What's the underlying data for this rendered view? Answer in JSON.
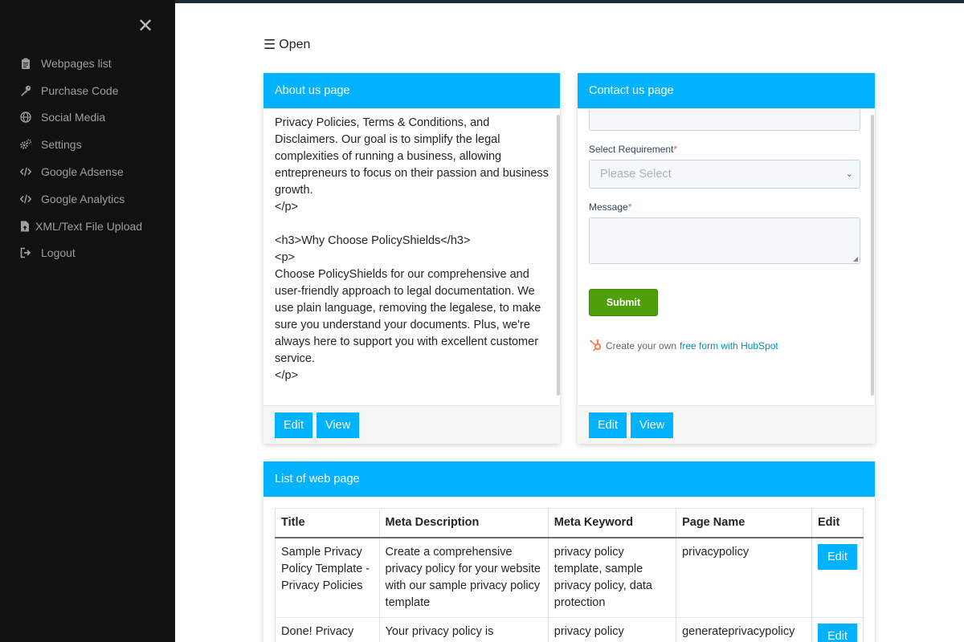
{
  "sidebar": {
    "items": [
      {
        "label": "Webpages list",
        "icon": "clipboard-icon"
      },
      {
        "label": "Purchase Code",
        "icon": "key-icon"
      },
      {
        "label": "Social Media",
        "icon": "globe-icon"
      },
      {
        "label": "Settings",
        "icon": "gears-icon"
      },
      {
        "label": "Google Adsense",
        "icon": "code-icon"
      },
      {
        "label": "Google Analytics",
        "icon": "code-icon"
      },
      {
        "label": "XML/Text File Upload",
        "icon": "file-upload-icon"
      },
      {
        "label": "Logout",
        "icon": "logout-icon"
      }
    ]
  },
  "header": {
    "open_label": "Open"
  },
  "about": {
    "title": "About us page",
    "body": "Privacy Policies, Terms & Conditions, and\nDisclaimers. Our goal is to simplify the legal\ncomplexities of running a business, allowing\nentrepreneurs to focus on their passion and business\ngrowth.\n</p>\n\n<h3>Why Choose PolicyShields</h3>\n<p>\nChoose PolicyShields for our comprehensive and\nuser-friendly approach to legal documentation. We\nuse plain language, removing the legalese, to make\nsure you understand your documents. Plus, we're\nalways here to support you with excellent customer\nservice.\n</p>",
    "edit_label": "Edit",
    "view_label": "View"
  },
  "contact": {
    "title": "Contact us page",
    "requirement_label": "Select Requirement",
    "requirement_placeholder": "Please Select",
    "message_label": "Message",
    "required_mark": "*",
    "submit_label": "Submit",
    "hubspot_text": "Create your own",
    "hubspot_link": "free form with HubSpot",
    "edit_label": "Edit",
    "view_label": "View"
  },
  "list": {
    "title": "List of web page",
    "columns": [
      "Title",
      "Meta Description",
      "Meta Keyword",
      "Page Name",
      "Edit"
    ],
    "rows": [
      {
        "title": "Sample Privacy Policy Template - Privacy Policies",
        "description": "Create a comprehensive privacy policy for your website with our sample privacy policy template",
        "keyword": "privacy policy template, sample privacy policy, data protection",
        "page_name": "privacypolicy",
        "edit": "Edit"
      },
      {
        "title": "Done! Privacy",
        "description": "Your privacy policy is",
        "keyword": "privacy policy",
        "page_name": "generateprivacypolicy",
        "edit": "Edit"
      }
    ]
  },
  "colors": {
    "accent": "#00b2ff",
    "sidebar_bg": "#111111",
    "submit_green": "#4f9f0b",
    "hubspot_orange": "#ff7a59"
  }
}
